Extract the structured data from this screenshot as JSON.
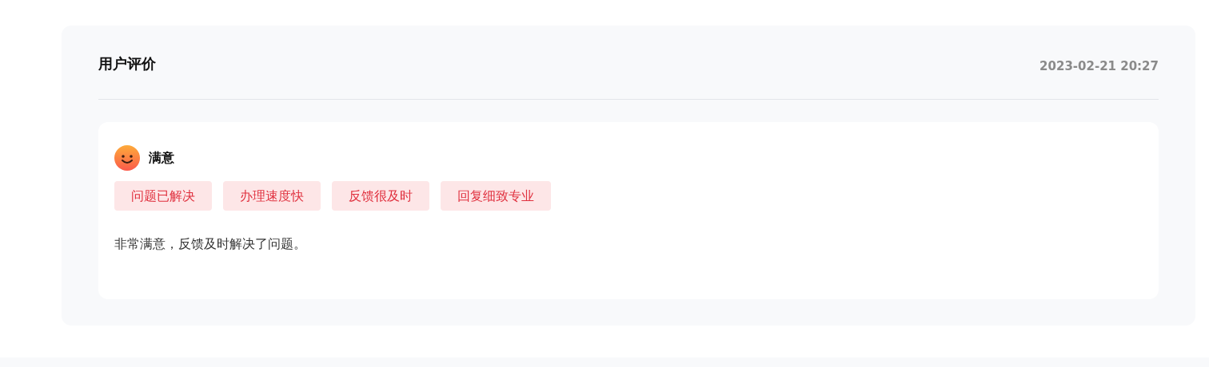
{
  "review": {
    "title": "用户评价",
    "time": "2023-02-21 20:27",
    "rating": {
      "kind": "satisfied",
      "label": "满意"
    },
    "tags": [
      "问题已解决",
      "办理速度快",
      "反馈很及时",
      "回复细致专业"
    ],
    "comment": "非常满意，反馈及时解决了问题。"
  }
}
